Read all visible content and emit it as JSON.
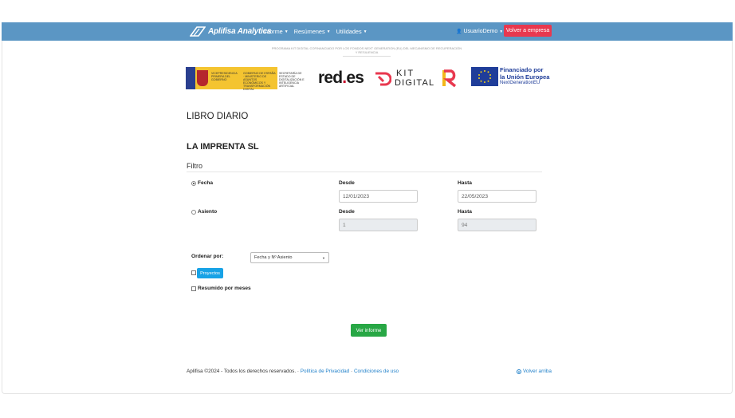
{
  "navbar": {
    "brand": "Aplifisa Analytics",
    "menu": [
      {
        "label": "Informe"
      },
      {
        "label": "Resúmenes"
      },
      {
        "label": "Utilidades"
      }
    ],
    "user": "UsuarioDemo",
    "company_button": "Volver a empresa",
    "accent_color": "#5b96c4",
    "danger_color": "#e8384f"
  },
  "funding": {
    "text": "PROGRAMA KIT DIGITAL COFINANCIADO POR LOS FONDOS NEXT GENERATION (EU) DEL MECANISMO DE RECUPERACIÓN Y RESILIENCIA",
    "logos": {
      "gob_1": "VICEPRESIDENCIA PRIMERA DEL GOBIERNO",
      "gob_2": "GOBIERNO DE ESPAÑA · MINISTERIO DE ASUNTOS ECONÓMICOS Y TRANSFORMACIÓN DIGITAL",
      "gob_3": "SECRETARÍA DE ESTADO DE DIGITALIZACIÓN E INTELIGENCIA ARTIFICIAL",
      "redes": "red",
      "redes_dot": ".",
      "redes_end": "es",
      "kit_1": "KIT",
      "kit_2": "DIGITAL",
      "eu_title_1": "Financiado por",
      "eu_title_2": "la Unión Europea",
      "eu_sub": "NextGenerationEU"
    }
  },
  "main": {
    "title": "LIBRO DIARIO",
    "company": "LA IMPRENTA SL",
    "filter_heading": "Filtro",
    "fecha": {
      "label": "Fecha",
      "selected": true,
      "desde_label": "Desde",
      "desde_value": "12/01/2023",
      "hasta_label": "Hasta",
      "hasta_value": "22/05/2023"
    },
    "asiento": {
      "label": "Asiento",
      "selected": false,
      "desde_label": "Desde",
      "desde_value": "1",
      "hasta_label": "Hasta",
      "hasta_value": "94"
    },
    "ordenar_label": "Ordenar por:",
    "ordenar_value": "Fecha y Nº Asiento",
    "proyectos_button": "Proyectos",
    "resumido_label": "Resumido por meses",
    "submit_button": "Ver informe"
  },
  "footer": {
    "copyright": "Aplifisa ©2024 - Todos los derechos reservados. · ",
    "privacy": "Política de Privacidad",
    "sep": " · ",
    "terms": "Condiciones de uso",
    "back_top": "Volver arriba"
  }
}
